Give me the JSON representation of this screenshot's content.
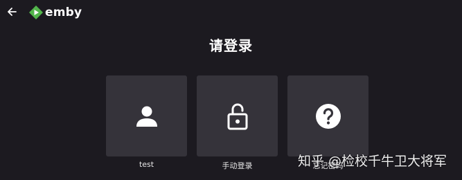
{
  "header": {
    "back_icon": "arrow-left-icon",
    "logo_icon": "emby-logo-icon",
    "logo_text": "emby"
  },
  "page": {
    "title": "请登录"
  },
  "tiles": [
    {
      "label": "test",
      "icon": "user-icon"
    },
    {
      "label": "手动登录",
      "icon": "unlocked-padlock-icon"
    },
    {
      "label": "忘记密码",
      "icon": "help-circle-icon"
    }
  ],
  "watermark": {
    "text": "知乎 @检校千牛卫大将军"
  },
  "colors": {
    "background": "#1c1a20",
    "tile": "#35333a",
    "brand_green": "#52b54b",
    "text": "#ffffff"
  }
}
